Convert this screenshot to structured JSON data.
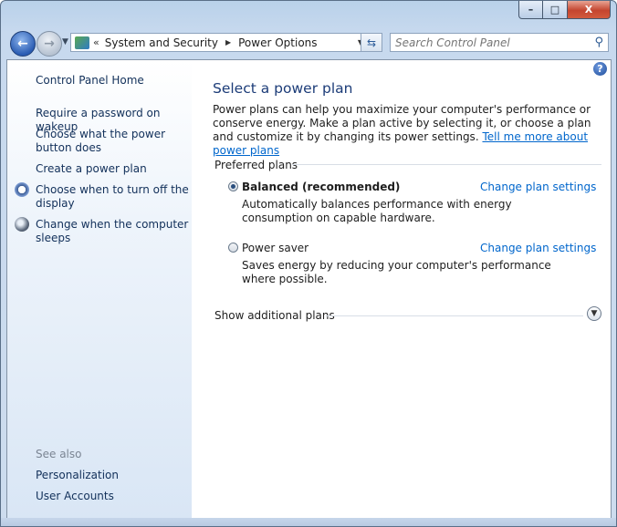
{
  "window": {
    "caption_min": "–",
    "caption_max": "□",
    "caption_close": "X"
  },
  "navbar": {
    "back_glyph": "←",
    "forward_glyph": "→",
    "breadcrumb_sep": "«",
    "breadcrumbs": [
      "System and Security",
      "Power Options"
    ],
    "search_placeholder": "Search Control Panel"
  },
  "sidebar": {
    "home": "Control Panel Home",
    "links": [
      "Require a password on wakeup",
      "Choose what the power button does",
      "Create a power plan",
      "Choose when to turn off the display",
      "Change when the computer sleeps"
    ],
    "see_also_label": "See also",
    "see_also": [
      "Personalization",
      "User Accounts"
    ]
  },
  "main": {
    "title": "Select a power plan",
    "intro": "Power plans can help you maximize your computer's performance or conserve energy. Make a plan active by selecting it, or choose a plan and customize it by changing its power settings.",
    "intro_link": "Tell me more about power plans",
    "group_label": "Preferred plans",
    "plans": [
      {
        "name": "Balanced (recommended)",
        "selected": true,
        "description": "Automatically balances performance with energy consumption on capable hardware.",
        "change_link": "Change plan settings"
      },
      {
        "name": "Power saver",
        "selected": false,
        "description": "Saves energy by reducing your computer's performance where possible.",
        "change_link": "Change plan settings"
      }
    ],
    "show_additional": "Show additional plans",
    "help_glyph": "?"
  }
}
